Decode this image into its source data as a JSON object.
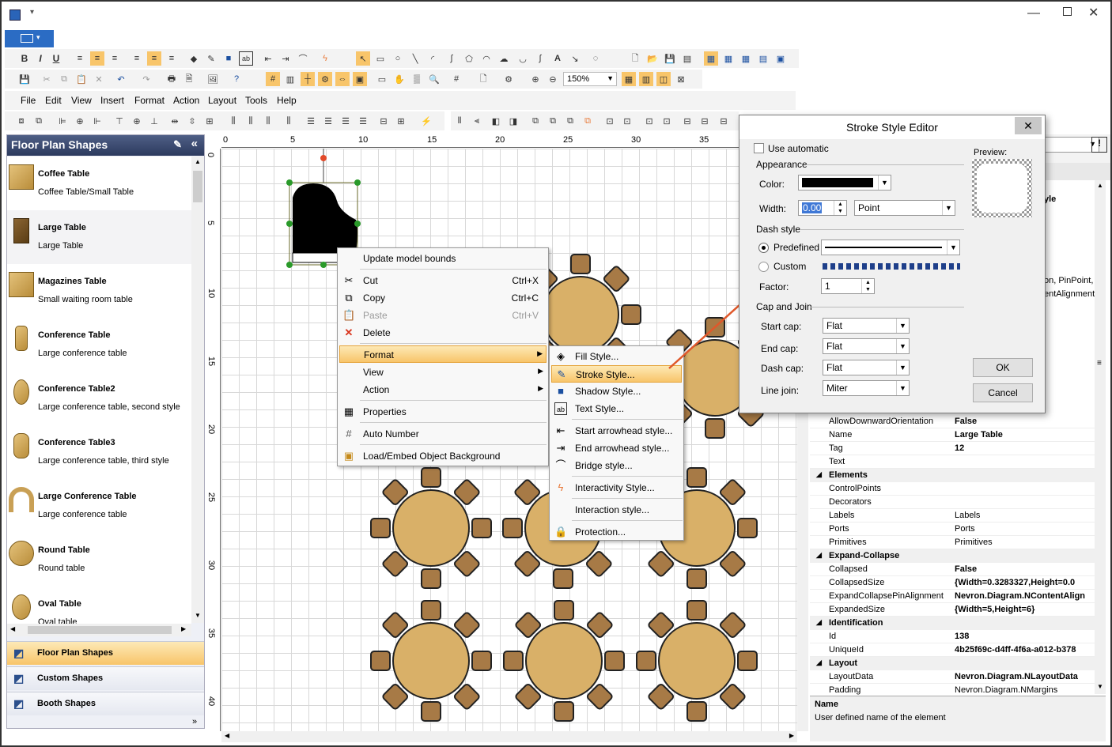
{
  "toolbar": {
    "zoom": "150%"
  },
  "menu": [
    "File",
    "Edit",
    "View",
    "Insert",
    "Format",
    "Action",
    "Layout",
    "Tools",
    "Help"
  ],
  "sidebar": {
    "title": "Floor Plan Shapes",
    "items": [
      {
        "name": "Coffee Table",
        "desc": "Coffee Table/Small Table"
      },
      {
        "name": "Large Table",
        "desc": "Large Table"
      },
      {
        "name": "Magazines Table",
        "desc": "Small waiting room table"
      },
      {
        "name": "Conference Table",
        "desc": "Large conference table"
      },
      {
        "name": "Conference Table2",
        "desc": "Large conference table, second style"
      },
      {
        "name": "Conference Table3",
        "desc": "Large conference table, third style"
      },
      {
        "name": "Large Conference Table",
        "desc": "Large conference table"
      },
      {
        "name": "Round Table",
        "desc": "Round table"
      },
      {
        "name": "Oval Table",
        "desc": "Oval table"
      }
    ],
    "nav": [
      "Floor Plan Shapes",
      "Custom Shapes",
      "Booth Shapes"
    ]
  },
  "ruler": {
    "h": [
      "0",
      "5",
      "10",
      "15",
      "20",
      "25",
      "30",
      "35"
    ],
    "v": [
      "0",
      "5",
      "10",
      "15",
      "20",
      "25",
      "30",
      "35",
      "40"
    ]
  },
  "context_menu": {
    "items": [
      {
        "label": "Update model bounds",
        "shortcut": ""
      },
      {
        "label": "Cut",
        "shortcut": "Ctrl+X"
      },
      {
        "label": "Copy",
        "shortcut": "Ctrl+C"
      },
      {
        "label": "Paste",
        "shortcut": "Ctrl+V"
      },
      {
        "label": "Delete",
        "shortcut": ""
      },
      {
        "label": "Format",
        "shortcut": ""
      },
      {
        "label": "View",
        "shortcut": ""
      },
      {
        "label": "Action",
        "shortcut": ""
      },
      {
        "label": "Properties",
        "shortcut": ""
      },
      {
        "label": "Auto Number",
        "shortcut": ""
      },
      {
        "label": "Load/Embed Object Background",
        "shortcut": ""
      }
    ]
  },
  "submenu": [
    "Fill Style...",
    "Stroke Style...",
    "Shadow Style...",
    "Text Style...",
    "Start arrowhead style...",
    "End arrowhead style...",
    "Bridge style...",
    "Interactivity Style...",
    "Interaction style...",
    "Protection..."
  ],
  "dialog": {
    "title": "Stroke Style Editor",
    "close": "✕",
    "use_automatic": "Use automatic",
    "preview": "Preview:",
    "appearance": "Appearance",
    "color_label": "Color:",
    "width_label": "Width:",
    "width_value": "0.00",
    "width_unit": "Point",
    "dash_style": "Dash style",
    "predefined": "Predefined",
    "custom": "Custom",
    "factor_label": "Factor:",
    "factor_value": "1",
    "cap_join": "Cap and Join",
    "start_cap_label": "Start cap:",
    "start_cap": "Flat",
    "end_cap_label": "End cap:",
    "end_cap": "Flat",
    "dash_cap_label": "Dash cap:",
    "dash_cap": "Flat",
    "line_join_label": "Line join:",
    "line_join": "Miter",
    "ok": "OK",
    "cancel": "Cancel"
  },
  "props_partial": {
    "r1": "yle",
    "r2": "on, PinPoint, S",
    "r3": "entAlignment"
  },
  "properties": [
    {
      "k": "AllowDownwardOrientation",
      "v": "False",
      "bold": true
    },
    {
      "k": "Name",
      "v": "Large Table",
      "bold": true
    },
    {
      "k": "Tag",
      "v": "12",
      "bold": true
    },
    {
      "k": "Text",
      "v": ""
    },
    {
      "cat": "Elements"
    },
    {
      "k": "ControlPoints",
      "v": ""
    },
    {
      "k": "Decorators",
      "v": ""
    },
    {
      "k": "Labels",
      "v": "Labels"
    },
    {
      "k": "Ports",
      "v": "Ports"
    },
    {
      "k": "Primitives",
      "v": "Primitives"
    },
    {
      "cat": "Expand-Collapse"
    },
    {
      "k": "Collapsed",
      "v": "False",
      "bold": true
    },
    {
      "k": "CollapsedSize",
      "v": "{Width=0.3283327,Height=0.0",
      "bold": true
    },
    {
      "k": "ExpandCollapsePinAlignment",
      "v": "Nevron.Diagram.NContentAlign",
      "bold": true
    },
    {
      "k": "ExpandedSize",
      "v": "{Width=5,Height=6}",
      "bold": true
    },
    {
      "cat": "Identification"
    },
    {
      "k": "Id",
      "v": "138",
      "bold": true
    },
    {
      "k": "UniqueId",
      "v": "4b25f69c-d4ff-4f6a-a012-b378",
      "bold": true
    },
    {
      "cat": "Layout"
    },
    {
      "k": "LayoutData",
      "v": "Nevron.Diagram.NLayoutData",
      "bold": true
    },
    {
      "k": "Padding",
      "v": "Nevron.Diagram.NMargins"
    }
  ],
  "help": {
    "title": "Name",
    "text": "User defined name of the element"
  },
  "colors": {
    "accent": "#e87a3a",
    "highlight": "#f8c56a",
    "table": "#d9b068"
  }
}
